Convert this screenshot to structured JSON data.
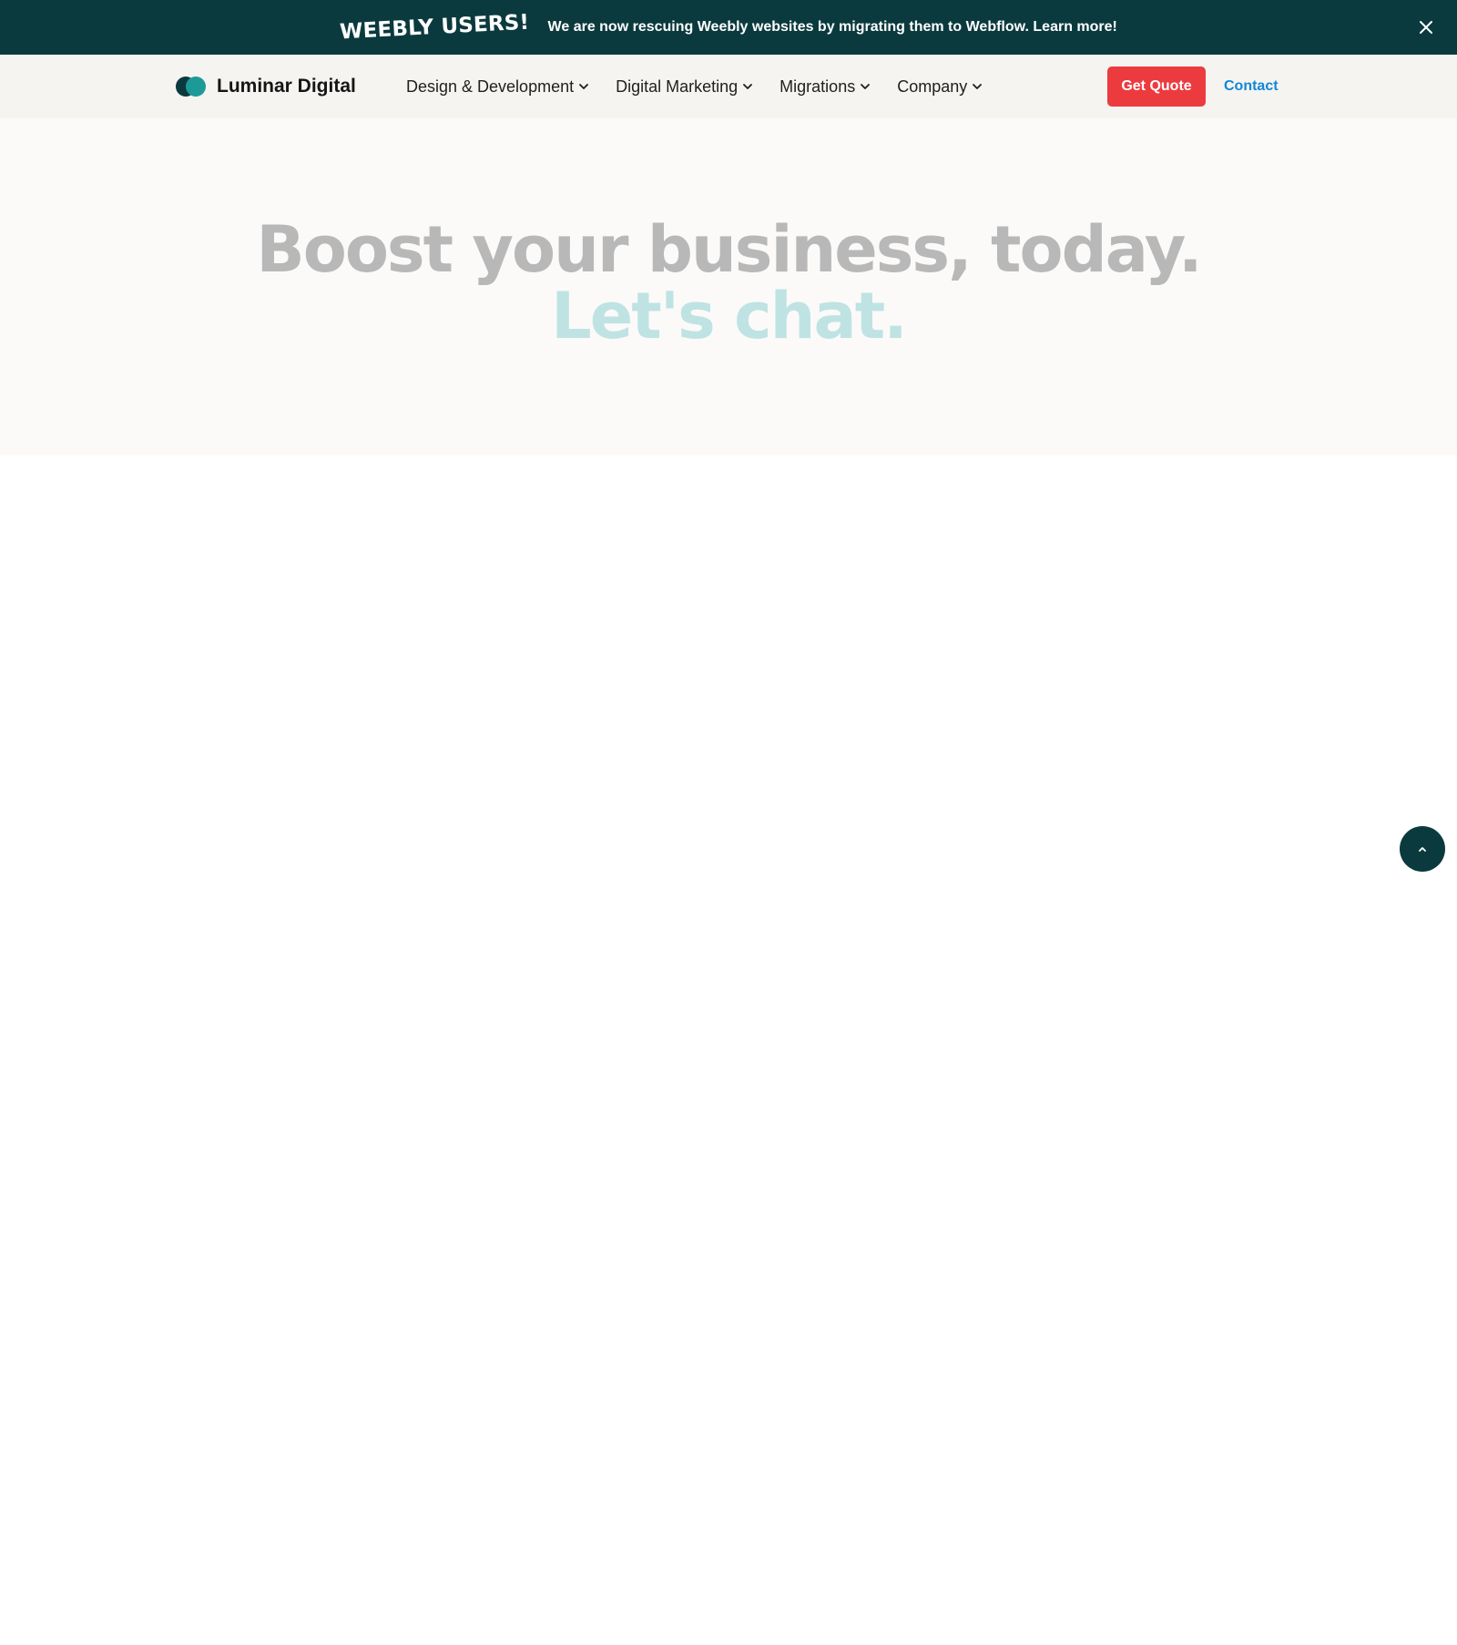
{
  "banner": {
    "badge": "WEEBLY USERS!",
    "message": "We are now rescuing Weebly websites by migrating them to Webflow.",
    "link": "Learn more!",
    "close_icon": "close-icon",
    "background": "#0b3a3e"
  },
  "navbar": {
    "logo_text": "Luminar Digital",
    "logo_colors": [
      "#0b3a3e",
      "#1b9a98"
    ],
    "menu": [
      {
        "label": "Design & Development",
        "icon": "chevron-down-icon"
      },
      {
        "label": "Digital Marketing",
        "icon": "chevron-down-icon"
      },
      {
        "label": "Migrations",
        "icon": "chevron-down-icon"
      },
      {
        "label": "Company",
        "icon": "chevron-down-icon"
      }
    ],
    "cta_label": "Get Quote",
    "cta_color": "#ec3b3e",
    "contact_label": "Contact",
    "contact_color": "#1187d6"
  },
  "hero": {
    "title": "Boost your business, today.",
    "subtitle": "Let's chat.",
    "title_color": "#b8b8b8",
    "subtitle_color": "#bfe3e3"
  },
  "scroll_top": {
    "icon": "chevron-up-icon"
  }
}
